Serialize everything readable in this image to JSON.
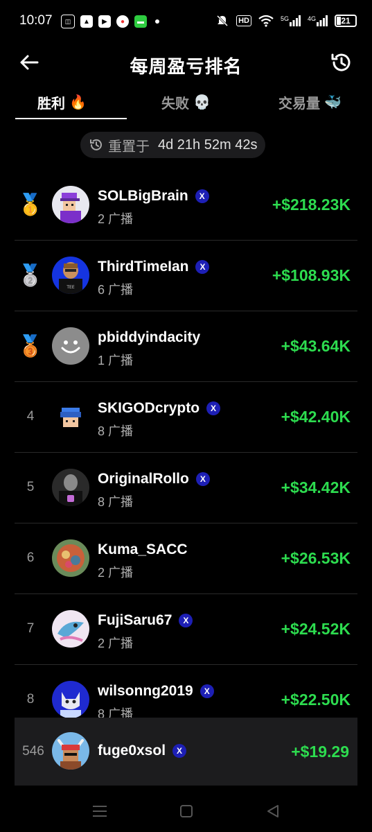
{
  "status_bar": {
    "time": "10:07",
    "network_5g": "5G",
    "network_4g": "4G",
    "hd": "HD",
    "battery": "21"
  },
  "header": {
    "title": "每周盈亏排名"
  },
  "tabs": [
    {
      "label": "胜利",
      "emoji": "🔥",
      "active": true
    },
    {
      "label": "失败",
      "emoji": "💀",
      "active": false
    },
    {
      "label": "交易量",
      "emoji": "🐳",
      "active": false
    }
  ],
  "reset": {
    "label": "重置于",
    "countdown": "4d 21h 52m 42s"
  },
  "leaderboard": [
    {
      "rank": "🥇",
      "name": "SOLBigBrain",
      "x_verified": true,
      "broadcasts": "2 广播",
      "pnl": "+$218.23K"
    },
    {
      "rank": "🥈",
      "name": "ThirdTimeIan",
      "x_verified": true,
      "broadcasts": "6 广播",
      "pnl": "+$108.93K"
    },
    {
      "rank": "🥉",
      "name": "pbiddyindacity",
      "x_verified": false,
      "broadcasts": "1 广播",
      "pnl": "+$43.64K"
    },
    {
      "rank": "4",
      "name": "SKIGODcrypto",
      "x_verified": true,
      "broadcasts": "8 广播",
      "pnl": "+$42.40K"
    },
    {
      "rank": "5",
      "name": "OriginalRollo",
      "x_verified": true,
      "broadcasts": "8 广播",
      "pnl": "+$34.42K"
    },
    {
      "rank": "6",
      "name": "Kuma_SACC",
      "x_verified": false,
      "broadcasts": "2 广播",
      "pnl": "+$26.53K"
    },
    {
      "rank": "7",
      "name": "FujiSaru67",
      "x_verified": true,
      "broadcasts": "2 广播",
      "pnl": "+$24.52K"
    },
    {
      "rank": "8",
      "name": "wilsonng2019",
      "x_verified": true,
      "broadcasts": "8 广播",
      "pnl": "+$22.50K"
    }
  ],
  "self": {
    "rank": "546",
    "name": "fuge0xsol",
    "x_verified": true,
    "pnl": "+$19.29"
  },
  "x_badge": "X",
  "colors": {
    "positive": "#2ddc4f",
    "background": "#000000",
    "x_badge": "#1d1fb5"
  }
}
